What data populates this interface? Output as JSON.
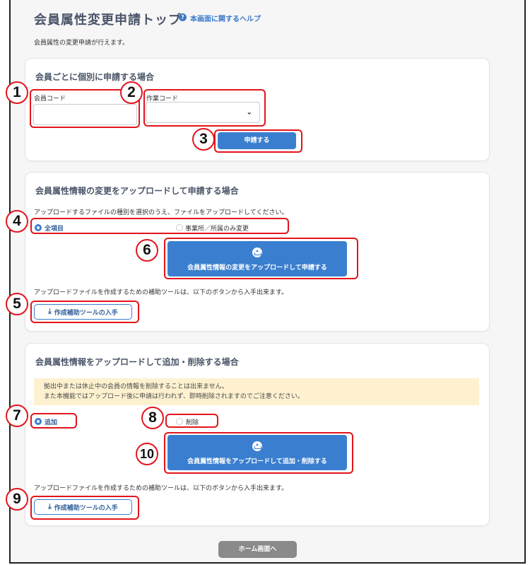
{
  "page": {
    "title": "会員属性変更申請トップ",
    "help_icon": "?",
    "help_link": "本画面に関するヘルプ",
    "description": "会員属性の変更申請が行えます。"
  },
  "section1": {
    "title": "会員ごとに個別に申請する場合",
    "member_code_label": "会員コード",
    "member_code_value": "",
    "work_code_label": "作業コード",
    "work_code_value": "",
    "work_code_arrow": "⌄",
    "apply_button": "申請する"
  },
  "section2": {
    "title": "会員属性情報の変更をアップロードして申請する場合",
    "instruction": "アップロードするファイルの種別を選択のうえ、ファイルをアップロードしてください。",
    "radio_all": "全項目",
    "radio_office": "事業所／所属のみ変更",
    "upload_button": "会員属性情報の変更をアップロードして申請する",
    "tool_note": "アップロードファイルを作成するための補助ツールは、以下のボタンから入手出来ます。",
    "tool_button": "作成補助ツールの入手"
  },
  "section3": {
    "title": "会員属性情報をアップロードして追加・削除する場合",
    "warning_line1": "拠出中または休止中の会員の情報を削除することは出来ません。",
    "warning_line2": "また本機能ではアップロード後に申請は行われず、即時削除されますのでご注意ください。",
    "radio_add": "追加",
    "radio_delete": "削除",
    "upload_button": "会員属性情報をアップロードして追加・削除する",
    "tool_note": "アップロードファイルを作成するための補助ツールは、以下のボタンから入手出来ます。",
    "tool_button": "作成補助ツールの入手"
  },
  "footer": {
    "home_button": "ホーム画面へ"
  },
  "callouts": [
    "1",
    "2",
    "3",
    "4",
    "5",
    "6",
    "7",
    "8",
    "9",
    "10"
  ],
  "icons": {
    "upload": "upload-icon",
    "download": "⤓",
    "select": "chevron-down-icon"
  },
  "colors": {
    "primary": "#3a7fcf",
    "highlight": "#e3141c",
    "warning_bg": "#fdf1cf",
    "home_button": "#8a8a8a"
  }
}
